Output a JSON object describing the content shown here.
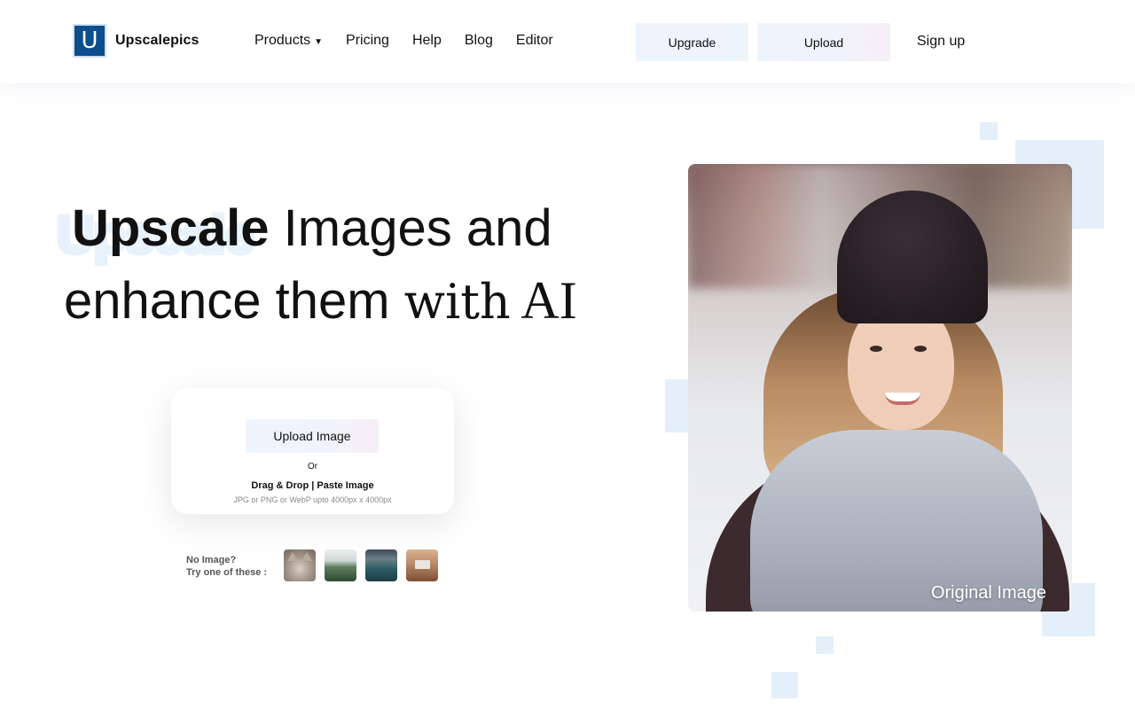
{
  "header": {
    "logo_letter": "U",
    "brand": "Upscalepics",
    "nav": [
      {
        "label": "Products",
        "has_dropdown": true,
        "caret": "▼"
      },
      {
        "label": "Pricing"
      },
      {
        "label": "Help"
      },
      {
        "label": "Blog"
      },
      {
        "label": "Editor"
      }
    ],
    "upgrade_label": "Upgrade",
    "upload_label": "Upload",
    "signup_label": "Sign up"
  },
  "hero": {
    "highlight": "Upscale",
    "line1_rest": " Images and",
    "line2_part1": "enhance them ",
    "line2_serif": "with",
    "line2_ai": " AI"
  },
  "upload_card": {
    "button_label": "Upload Image",
    "or_text": "Or",
    "drag_text": "Drag & Drop | Paste Image",
    "hint_text": "JPG or PNG or WebP upto 4000px x 4000px"
  },
  "samples": {
    "label_line1": "No Image?",
    "label_line2": "Try one of these :",
    "thumbnails": [
      "cat",
      "mountain-lake",
      "city-canal",
      "laptop-desk"
    ]
  },
  "preview": {
    "label": "Original Image"
  },
  "colors": {
    "brand_blue": "#0d4d8b",
    "accent_light": "#e4effa",
    "button_bg": "#eef4fc"
  }
}
